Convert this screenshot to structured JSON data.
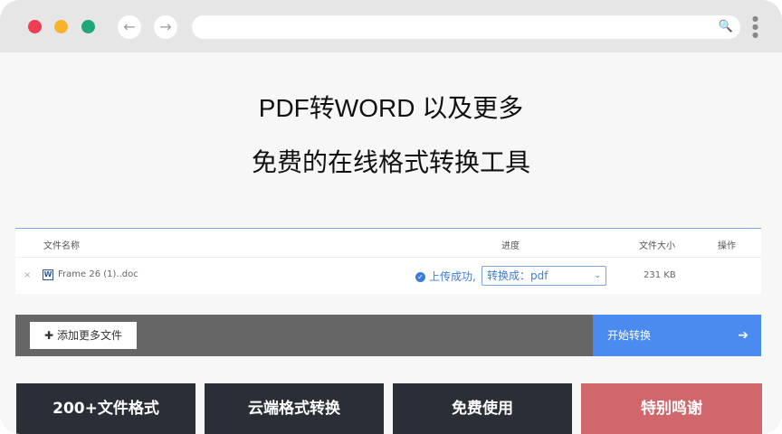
{
  "browser": {
    "back_icon": "←",
    "forward_icon": "→",
    "search_icon": "🔍",
    "menu_icon": "⋮"
  },
  "hero": {
    "line1": "PDF转WORD 以及更多",
    "line2": "免费的在线格式转换工具"
  },
  "table": {
    "headers": {
      "name": "文件名称",
      "progress": "进度",
      "size": "文件大小",
      "action": "操作"
    },
    "rows": [
      {
        "remove": "×",
        "type_icon": "W",
        "name": "Frame 26 (1)..doc",
        "status": "上传成功,",
        "convert_to": "转换成：pdf",
        "size": "231 KB"
      }
    ]
  },
  "actions": {
    "add_more": "添加更多文件",
    "add_icon": "✚",
    "start": "开始转换",
    "start_icon": "➔"
  },
  "features": [
    "200+文件格式",
    "云端格式转换",
    "免费使用",
    "特别鸣谢"
  ],
  "colors": {
    "accent": "#4a8bf0",
    "dark_card": "#2a2e36",
    "thanks_card": "#d0676c",
    "action_bar": "#666666"
  }
}
